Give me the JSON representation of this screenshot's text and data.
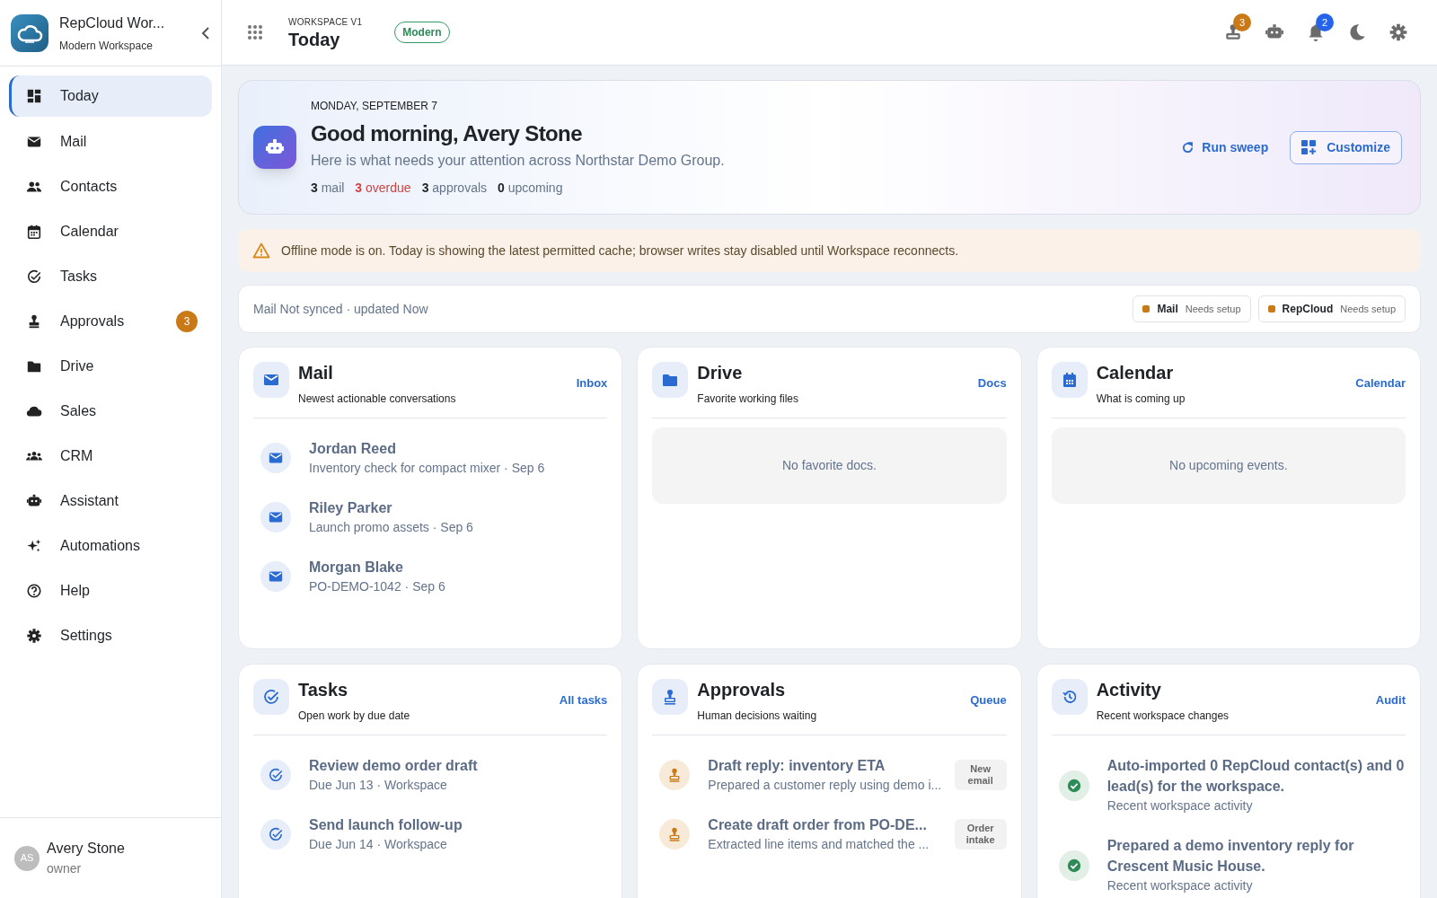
{
  "sidebar": {
    "app_name": "RepCloud Wor...",
    "app_subtitle": "Modern Workspace",
    "items": [
      {
        "label": "Today",
        "selected": true
      },
      {
        "label": "Mail",
        "selected": false
      },
      {
        "label": "Contacts",
        "selected": false
      },
      {
        "label": "Calendar",
        "selected": false
      },
      {
        "label": "Tasks",
        "selected": false
      },
      {
        "label": "Approvals",
        "selected": false,
        "badge": "3"
      },
      {
        "label": "Drive",
        "selected": false
      },
      {
        "label": "Sales",
        "selected": false
      },
      {
        "label": "CRM",
        "selected": false
      },
      {
        "label": "Assistant",
        "selected": false
      },
      {
        "label": "Automations",
        "selected": false
      },
      {
        "label": "Help",
        "selected": false
      },
      {
        "label": "Settings",
        "selected": false
      }
    ],
    "user": {
      "initials": "AS",
      "name": "Avery Stone",
      "role": "owner"
    }
  },
  "header": {
    "eyebrow": "WORKSPACE V1",
    "title": "Today",
    "badge": "Modern",
    "badges": [
      {
        "count": "3",
        "color": "#c97a16"
      },
      {
        "count": "2",
        "color": "#2563eb"
      }
    ]
  },
  "hero": {
    "date": "MONDAY, SEPTEMBER 7",
    "greeting": "Good morning, Avery Stone",
    "subtitle": "Here is what needs your attention across Northstar Demo Group.",
    "stats": [
      {
        "count": "3",
        "label": "mail",
        "alert": false
      },
      {
        "count": "3",
        "label": "overdue",
        "alert": true
      },
      {
        "count": "3",
        "label": "approvals",
        "alert": false
      },
      {
        "count": "0",
        "label": "upcoming",
        "alert": false
      }
    ],
    "run_button": "Run sweep",
    "customize_button": "Customize"
  },
  "banner": "Offline mode is on. Today is showing the latest permitted cache; browser writes stay disabled until Workspace reconnects.",
  "sync": {
    "text": "Mail Not synced · updated Now",
    "chips": [
      {
        "name": "Mail",
        "status": "Needs setup",
        "color": "#c97a16"
      },
      {
        "name": "RepCloud",
        "status": "Needs setup",
        "color": "#c97a16"
      }
    ]
  },
  "cards": [
    {
      "kind": "list",
      "title": "Mail",
      "subtitle": "Newest actionable conversations",
      "link": "Inbox",
      "items": [
        {
          "title": "Jordan Reed",
          "subtitle": "Inventory check for compact mixer · Sep 6"
        },
        {
          "title": "Riley Parker",
          "subtitle": "Launch promo assets · Sep 6"
        },
        {
          "title": "Morgan Blake",
          "subtitle": "PO-DEMO-1042 · Sep 6"
        }
      ]
    },
    {
      "kind": "empty",
      "title": "Drive",
      "subtitle": "Favorite working files",
      "link": "Docs",
      "empty_text": "No favorite docs."
    },
    {
      "kind": "empty",
      "title": "Calendar",
      "subtitle": "What is coming up",
      "link": "Calendar",
      "empty_text": "No upcoming events."
    },
    {
      "kind": "list",
      "title": "Tasks",
      "subtitle": "Open work by due date",
      "link": "All tasks",
      "items": [
        {
          "title": "Review demo order draft",
          "subtitle": "Due Jun 13 · Workspace"
        },
        {
          "title": "Send launch follow-up",
          "subtitle": "Due Jun 14 · Workspace"
        }
      ]
    },
    {
      "kind": "list",
      "title": "Approvals",
      "subtitle": "Human decisions waiting",
      "link": "Queue",
      "items": [
        {
          "title": "Draft reply: inventory ETA",
          "subtitle": "Prepared a customer reply using demo i...",
          "tag": "New email"
        },
        {
          "title": "Create draft order from PO-DE...",
          "subtitle": "Extracted line items and matched the ...",
          "tag": "Order intake"
        }
      ]
    },
    {
      "kind": "list",
      "title": "Activity",
      "subtitle": "Recent workspace changes",
      "link": "Audit",
      "items": [
        {
          "title": "Auto-imported 0 RepCloud contact(s) and 0 lead(s) for the workspace.",
          "subtitle": "Recent workspace activity"
        },
        {
          "title": "Prepared a demo inventory reply for Crescent Music House.",
          "subtitle": "Recent workspace activity"
        }
      ]
    }
  ]
}
